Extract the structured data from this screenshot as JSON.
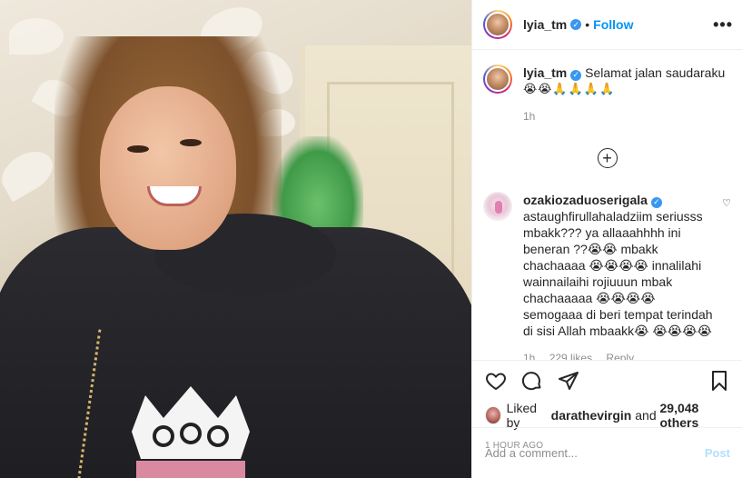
{
  "post": {
    "image_alt": "Photo of a smiling woman in a black hoodie with a crown print"
  },
  "header": {
    "username": "lyia_tm",
    "dot": "•",
    "follow_label": "Follow",
    "more_label": "•••"
  },
  "caption": {
    "username": "lyia_tm",
    "text": "Selamat jalan saudaraku",
    "emojis": "😭😭🙏🙏🙏🙏",
    "time": "1h"
  },
  "load_more": "+",
  "comments": [
    {
      "username": "ozakiozaduoserigala",
      "text": "astaughfirullahaladziim seriusss mbakk??? ya allaaahhhh ini beneran ??😭😭 mbakk chachaaaa 😭😭😭😭 innalilahi wainnailaihi rojiuuun mbak chachaaaaa 😭😭😭😭 semogaaa di beri tempat terindah di sisi Allah mbaakk😭 😭😭😭😭",
      "time": "1h",
      "likes": "229 likes",
      "reply_label": "Reply"
    }
  ],
  "likes": {
    "prefix": "Liked by",
    "user": "darathevirgin",
    "and": "and",
    "others": "29,048 others"
  },
  "timestamp": "1 HOUR AGO",
  "add_comment": {
    "placeholder": "Add a comment...",
    "post_label": "Post"
  },
  "colors": {
    "accent": "#0095f6",
    "verified": "#3897f0",
    "muted": "#8e8e8e",
    "post_disabled": "#b2dffc"
  },
  "icons": [
    "verified-icon",
    "more-icon",
    "plus-circle-icon",
    "heart-icon",
    "comment-icon",
    "share-icon",
    "bookmark-icon"
  ]
}
